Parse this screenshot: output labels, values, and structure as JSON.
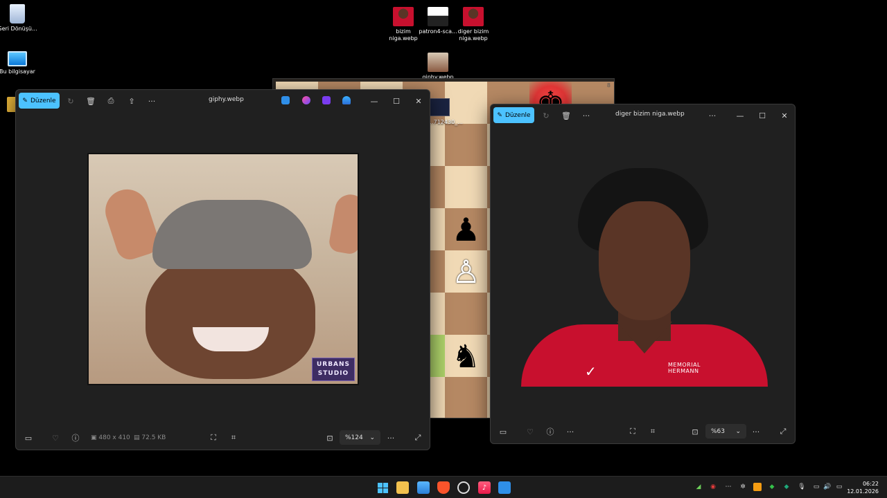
{
  "desktop": {
    "icons": [
      {
        "label": "Geri Dönüşü...",
        "icon": "recycle-bin-icon"
      },
      {
        "label": "Bu bilgisayar",
        "icon": "computer-icon"
      },
      {
        "label": "bizim niga.webp",
        "icon": "image-thumbnail"
      },
      {
        "label": "patron4-sca...",
        "icon": "image-thumbnail"
      },
      {
        "label": "diger bizim niga.webp",
        "icon": "image-thumbnail"
      },
      {
        "label": "giphy.webp",
        "icon": "image-thumbnail"
      },
      {
        "label": "...712430_...",
        "icon": "image-thumbnail"
      }
    ]
  },
  "chess": {
    "corner_label": "8"
  },
  "viewer1": {
    "edit_label": "Düzenle",
    "title": "giphy.webp",
    "image_watermark": "URBANS STUDIO",
    "dimensions": "480 x 410",
    "file_size": "72.5 KB",
    "zoom": "%124"
  },
  "viewer2": {
    "edit_label": "Düzenle",
    "title": "diger bizim niga.webp",
    "jersey_text": "MEMORIAL HERMANN",
    "zoom": "%63"
  },
  "taskbar": {
    "time": "06:22",
    "date": "12.01.2026"
  }
}
